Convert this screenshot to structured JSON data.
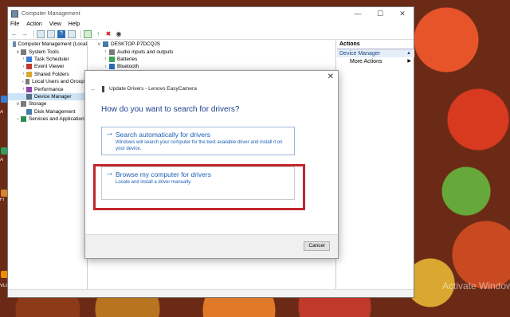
{
  "window": {
    "title": "Computer Management",
    "controls": [
      "—",
      "☐",
      "✕"
    ]
  },
  "menu": [
    "File",
    "Action",
    "View",
    "Help"
  ],
  "tree": [
    {
      "label": "Computer Management (Local",
      "indent": 0,
      "toggle": "",
      "selected": false
    },
    {
      "label": "System Tools",
      "indent": 1,
      "toggle": "∨",
      "selected": false
    },
    {
      "label": "Task Scheduler",
      "indent": 2,
      "toggle": "›",
      "selected": false
    },
    {
      "label": "Event Viewer",
      "indent": 2,
      "toggle": "›",
      "selected": false
    },
    {
      "label": "Shared Folders",
      "indent": 2,
      "toggle": "›",
      "selected": false
    },
    {
      "label": "Local Users and Groups",
      "indent": 2,
      "toggle": "›",
      "selected": false
    },
    {
      "label": "Performance",
      "indent": 2,
      "toggle": "›",
      "selected": false
    },
    {
      "label": "Device Manager",
      "indent": 2,
      "toggle": "",
      "selected": true
    },
    {
      "label": "Storage",
      "indent": 1,
      "toggle": "∨",
      "selected": false
    },
    {
      "label": "Disk Management",
      "indent": 2,
      "toggle": "",
      "selected": false
    },
    {
      "label": "Services and Applications",
      "indent": 1,
      "toggle": "›",
      "selected": false
    }
  ],
  "devices": [
    {
      "label": "DESKTOP-P7DCQJS",
      "toggle": "∨",
      "indent": 0
    },
    {
      "label": "Audio inputs and outputs",
      "toggle": "›",
      "indent": 1
    },
    {
      "label": "Batteries",
      "toggle": "›",
      "indent": 1
    },
    {
      "label": "Bluetooth",
      "toggle": "›",
      "indent": 1
    }
  ],
  "actions": {
    "header": "Actions",
    "section": "Device Manager",
    "more": "More Actions"
  },
  "dialog": {
    "title": "Update Drivers - Lenovo EasyCamera",
    "question": "How do you want to search for drivers?",
    "option1_title": "Search automatically for drivers",
    "option1_desc": "Windows will search your computer for the best available driver and install it on your device.",
    "option2_title": "Browse my computer for drivers",
    "option2_desc": "Locate and install a driver manually.",
    "cancel": "Cancel"
  },
  "desktop": {
    "labels": [
      "A",
      "A",
      "Fi",
      "VLC"
    ],
    "watermark": "Activate Windows"
  },
  "colors": {
    "accent_blue": "#1a5fb4",
    "highlight_red": "#c1272d",
    "selection": "#cce4f7"
  }
}
